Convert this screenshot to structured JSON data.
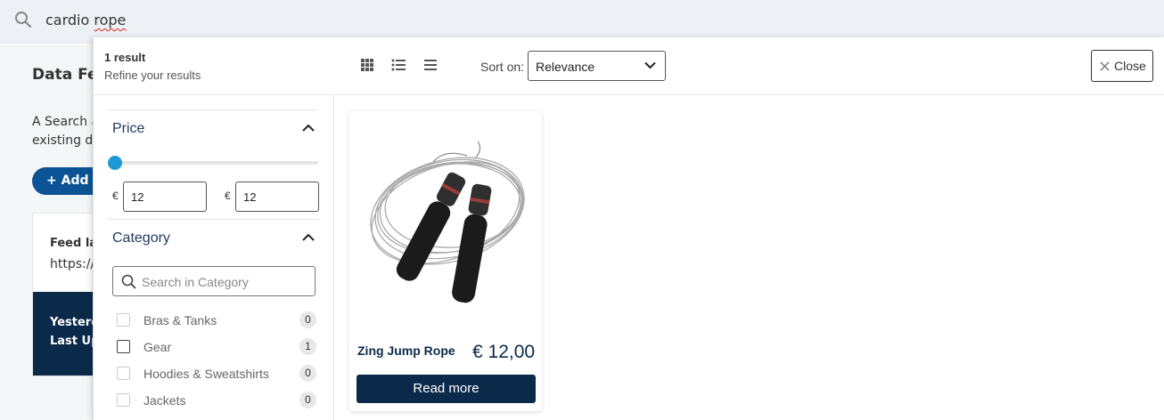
{
  "search": {
    "query_before": "cardio ",
    "query_misspelled": "rope"
  },
  "background": {
    "title": "Data Feed",
    "desc_line1": "A Search a",
    "desc_line2": "existing da",
    "add_label": "Add f",
    "card_label": "Feed la",
    "card_url": "https://",
    "dark_line1": "Yesterda",
    "dark_line2": "Last Up"
  },
  "results": {
    "count": "1 result",
    "refine": "Refine your results",
    "sort_label": "Sort on:",
    "sort_value": "Relevance",
    "close_label": "Close"
  },
  "filters": {
    "price": {
      "title": "Price",
      "currency": "€",
      "min": "12",
      "max": "12"
    },
    "category": {
      "title": "Category",
      "search_placeholder": "Search in Category",
      "items": [
        {
          "name": "Bras & Tanks",
          "count": "0",
          "checked": false
        },
        {
          "name": "Gear",
          "count": "1",
          "checked": false
        },
        {
          "name": "Hoodies & Sweatshirts",
          "count": "0",
          "checked": false
        },
        {
          "name": "Jackets",
          "count": "0",
          "checked": false
        }
      ]
    }
  },
  "products": [
    {
      "name": "Zing Jump Rope",
      "price": "€ 12,00",
      "button": "Read more"
    }
  ],
  "colors": {
    "accent": "#1a9bd7",
    "navy": "#0b2a4a",
    "blue": "#0b5394"
  }
}
